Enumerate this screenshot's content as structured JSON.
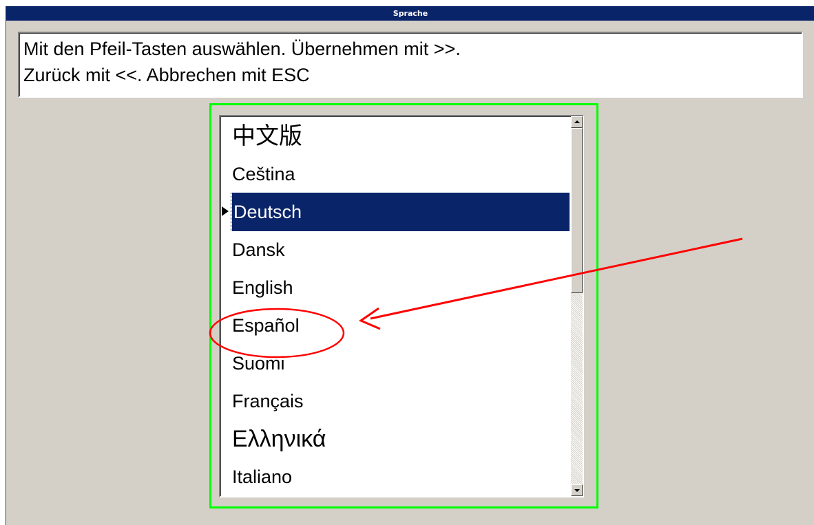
{
  "window": {
    "title": "Sprache"
  },
  "instructions": {
    "line1": "Mit den Pfeil-Tasten auswählen. Übernehmen mit >>.",
    "line2": "Zurück mit <<. Abbrechen mit ESC"
  },
  "language_list": {
    "items": [
      {
        "label": "中文版"
      },
      {
        "label": "Ceština"
      },
      {
        "label": "Deutsch"
      },
      {
        "label": "Dansk"
      },
      {
        "label": "English"
      },
      {
        "label": "Español"
      },
      {
        "label": "Suomi"
      },
      {
        "label": "Français"
      },
      {
        "label": "Ελληνικά"
      },
      {
        "label": "Italiano"
      }
    ],
    "selected": "Deutsch",
    "highlighted_by_annotation": "Español"
  },
  "colors": {
    "titlebar": "#0a246a",
    "selection": "#0a246a",
    "window_bg": "#d4d0c8",
    "focus_frame": "#00ff00",
    "annotation": "#ff0000"
  },
  "icons": {
    "row_marker": "triangle-right-icon",
    "scroll_up": "arrow-up-icon",
    "scroll_down": "arrow-down-icon"
  }
}
